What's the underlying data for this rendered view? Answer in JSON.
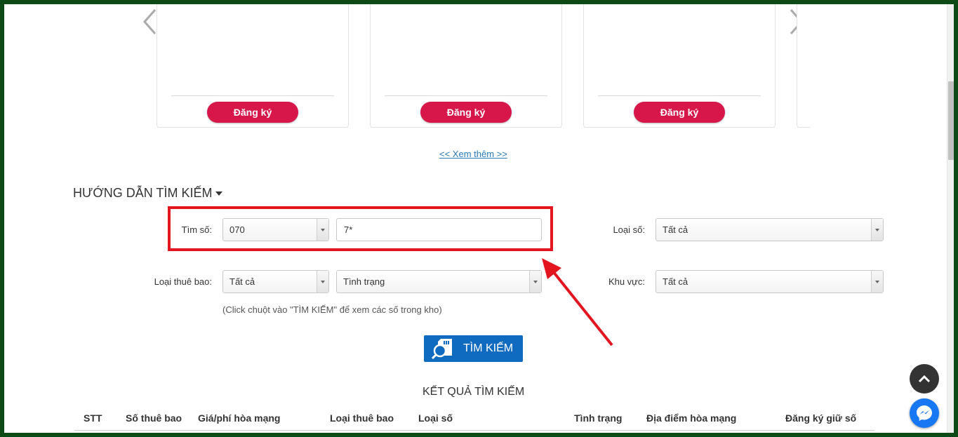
{
  "carousel": {
    "prev_icon": "chevron-left-icon",
    "next_icon": "chevron-right-icon",
    "cards": [
      {
        "register_label": "Đăng ký"
      },
      {
        "register_label": "Đăng ký"
      },
      {
        "register_label": "Đăng ký"
      }
    ],
    "see_more": "<< Xem thêm >>"
  },
  "search": {
    "title": "HƯỚNG DẪN TÌM KIẾM",
    "number_label": "Tìm số:",
    "prefix_value": "070",
    "number_value": "7*",
    "number_type_label": "Loại số:",
    "number_type_value": "Tất cả",
    "subscriber_type_label": "Loại thuê bao:",
    "subscriber_type_value": "Tất cả",
    "status_value": "Tình trạng",
    "region_label": "Khu vực:",
    "region_value": "Tất cả",
    "hint": "(Click chuột vào \"TÌM KIẾM\" để xem các số trong kho)",
    "button_label": "TÌM KIẾM"
  },
  "results": {
    "title": "KẾT QUẢ TÌM KIẾM",
    "columns": [
      "STT",
      "Số thuê bao",
      "Giá/phí hòa mạng",
      "Loại thuê bao",
      "Loại số",
      "Tình trạng",
      "Địa điểm hòa mạng",
      "Đăng ký giữ số"
    ]
  },
  "colors": {
    "register_button": "#d7174a",
    "search_button": "#0f6bbf",
    "highlight": "#e3161f",
    "link": "#2a7ab8"
  }
}
